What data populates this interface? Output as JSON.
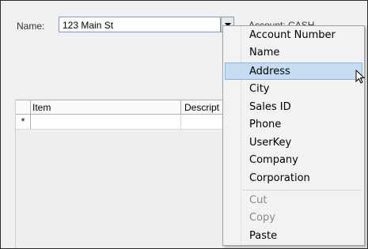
{
  "form": {
    "name_label": "Name:",
    "name_value": "123 Main St",
    "account_text": "Account: CASH"
  },
  "grid": {
    "columns": [
      "Item",
      "Descript"
    ],
    "new_row_marker": "*"
  },
  "context_menu": {
    "items": [
      {
        "label": "Account Number",
        "enabled": true,
        "highlighted": false
      },
      {
        "label": "Name",
        "enabled": true,
        "highlighted": false
      },
      {
        "label": "Address",
        "enabled": true,
        "highlighted": true
      },
      {
        "label": "City",
        "enabled": true,
        "highlighted": false
      },
      {
        "label": "Sales ID",
        "enabled": true,
        "highlighted": false
      },
      {
        "label": "Phone",
        "enabled": true,
        "highlighted": false
      },
      {
        "label": "UserKey",
        "enabled": true,
        "highlighted": false
      },
      {
        "label": "Company",
        "enabled": true,
        "highlighted": false
      },
      {
        "label": "Corporation",
        "enabled": true,
        "highlighted": false
      }
    ],
    "edit_items": [
      {
        "label": "Cut",
        "enabled": false
      },
      {
        "label": "Copy",
        "enabled": false
      },
      {
        "label": "Paste",
        "enabled": true
      }
    ]
  },
  "colors": {
    "highlight": "#c5dcf3",
    "highlight_border": "#86b5e3",
    "disabled_text": "#8a8a8a"
  }
}
